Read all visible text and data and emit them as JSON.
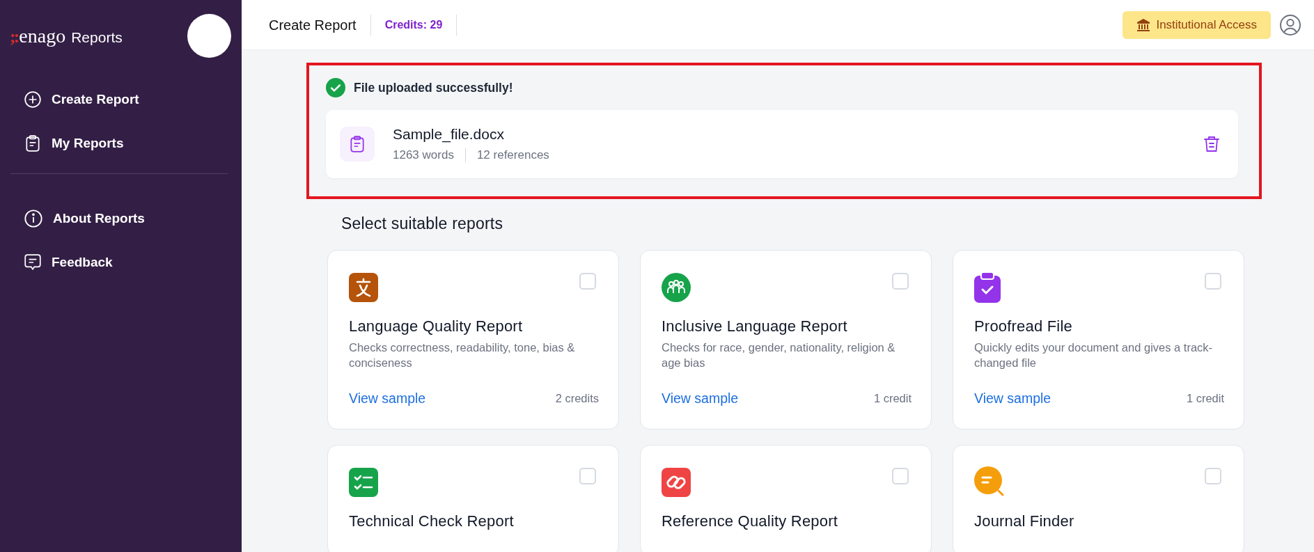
{
  "sidebar": {
    "logo": {
      "mark": ";:",
      "name": "enago",
      "product": "Reports"
    },
    "items": [
      {
        "label": "Create Report",
        "selected": false
      },
      {
        "label": "My Reports",
        "selected": false
      }
    ],
    "secondary_items": [
      {
        "label": "About Reports"
      },
      {
        "label": "Feedback"
      }
    ]
  },
  "header": {
    "title": "Create Report",
    "credits": "Credits: 29",
    "access_button": "Institutional Access"
  },
  "upload": {
    "highlighted": true,
    "message": "File uploaded successfully!",
    "file": {
      "name": "Sample_file.docx",
      "words": "1263 words",
      "references": "12 references"
    }
  },
  "section_title": "Select suitable reports",
  "reports": [
    {
      "title": "Language Quality Report",
      "description": "Checks correctness, readability, tone, bias & conciseness",
      "link": "View sample",
      "credits": "2 credits",
      "checked": false
    },
    {
      "title": "Inclusive Language Report",
      "description": "Checks for race, gender, nationality, religion & age bias",
      "link": "View sample",
      "credits": "1 credit",
      "checked": false
    },
    {
      "title": "Proofread File",
      "description": "Quickly edits your document and gives a track-changed file",
      "link": "View sample",
      "credits": "1 credit",
      "checked": false
    },
    {
      "title": "Technical Check Report",
      "checked": false
    },
    {
      "title": "Reference Quality Report",
      "checked": false
    },
    {
      "title": "Journal Finder",
      "checked": false
    }
  ]
}
